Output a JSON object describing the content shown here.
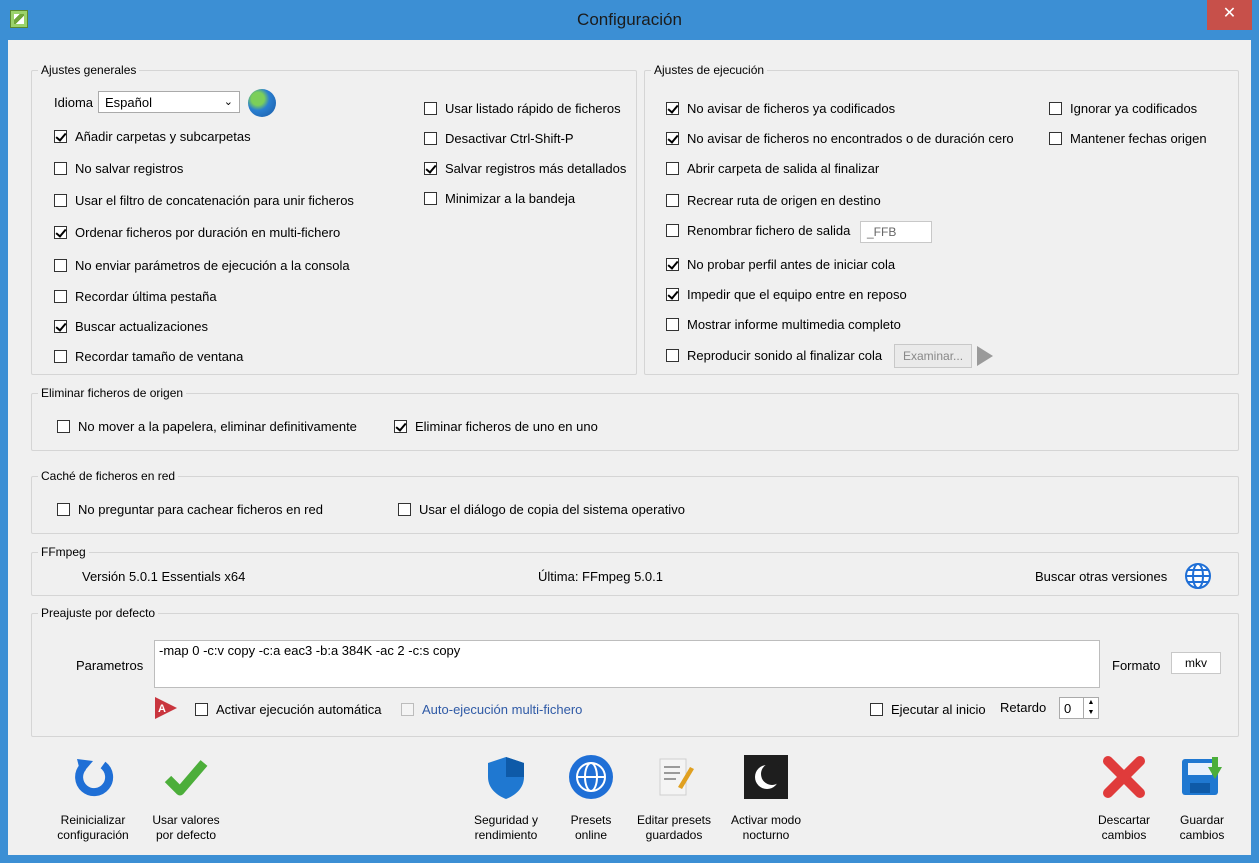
{
  "window": {
    "title": "Configuración",
    "close_glyph": "✕"
  },
  "general": {
    "label": "Ajustes generales",
    "idioma_label": "Idioma",
    "idioma_value": "Español",
    "col1": [
      {
        "label": "Añadir carpetas y subcarpetas",
        "checked": true
      },
      {
        "label": "No salvar registros",
        "checked": false
      },
      {
        "label": "Usar el filtro de concatenación para unir ficheros",
        "checked": false
      },
      {
        "label": "Ordenar ficheros por duración en multi-fichero",
        "checked": true
      },
      {
        "label": "No enviar parámetros de ejecución a la consola",
        "checked": false
      },
      {
        "label": "Recordar última pestaña",
        "checked": false
      },
      {
        "label": "Buscar actualizaciones",
        "checked": true
      },
      {
        "label": "Recordar tamaño de ventana",
        "checked": false
      }
    ],
    "col2": [
      {
        "label": "Usar listado rápido de ficheros",
        "checked": false
      },
      {
        "label": "Desactivar Ctrl-Shift-P",
        "checked": false
      },
      {
        "label": "Salvar registros más detallados",
        "checked": true
      },
      {
        "label": "Minimizar a la bandeja",
        "checked": false
      }
    ]
  },
  "exec": {
    "label": "Ajustes de ejecución",
    "col1": [
      {
        "label": "No avisar de ficheros ya codificados",
        "checked": true
      },
      {
        "label": "No avisar de ficheros no encontrados o de duración cero",
        "checked": true
      },
      {
        "label": "Abrir carpeta de salida al finalizar",
        "checked": false
      },
      {
        "label": "Recrear ruta de origen en destino",
        "checked": false
      },
      {
        "label": "Renombrar fichero de salida",
        "checked": false
      },
      {
        "label": "No probar perfil antes de iniciar cola",
        "checked": true
      },
      {
        "label": "Impedir que el equipo entre en reposo",
        "checked": true
      },
      {
        "label": "Mostrar informe multimedia completo",
        "checked": false
      },
      {
        "label": "Reproducir sonido al finalizar cola",
        "checked": false
      }
    ],
    "col2": [
      {
        "label": "Ignorar ya codificados",
        "checked": false
      },
      {
        "label": "Mantener fechas origen",
        "checked": false
      }
    ],
    "rename_suffix": "_FFB",
    "browse_label": "Examinar..."
  },
  "delete": {
    "label": "Eliminar ficheros de origen",
    "items": [
      {
        "label": "No mover a la papelera, eliminar definitivamente",
        "checked": false
      },
      {
        "label": "Eliminar ficheros de uno en uno",
        "checked": true
      }
    ]
  },
  "cache": {
    "label": "Caché de ficheros en red",
    "items": [
      {
        "label": "No preguntar para cachear ficheros en red",
        "checked": false
      },
      {
        "label": "Usar el diálogo de copia del sistema operativo",
        "checked": false
      }
    ]
  },
  "ffmpeg": {
    "label": "FFmpeg",
    "version": "Versión 5.0.1 Essentials  x64",
    "latest": "Última:  FFmpeg 5.0.1",
    "search_label": "Buscar otras versiones"
  },
  "preset": {
    "label": "Preajuste por defecto",
    "params_label": "Parametros",
    "params_value": "-map 0 -c:v copy -c:a eac3 -b:a 384K -ac 2 -c:s copy",
    "format_label": "Formato",
    "format_value": "mkv",
    "auto_exec": {
      "label": "Activar ejecución automática",
      "checked": false
    },
    "auto_multi": {
      "label": "Auto-ejecución multi-fichero",
      "checked": false
    },
    "run_start": {
      "label": "Ejecutar al inicio",
      "checked": false
    },
    "delay_label": "Retardo",
    "delay_value": "0"
  },
  "toolbar": {
    "reset": "Reinicializar\nconfiguración",
    "defaults": "Usar valores\npor defecto",
    "security": "Seguridad y\nrendimiento",
    "presets_online": "Presets\nonline",
    "edit_presets": "Editar presets\nguardados",
    "night_mode": "Activar modo\nnocturno",
    "discard": "Descartar\ncambios",
    "save": "Guardar\ncambios"
  }
}
